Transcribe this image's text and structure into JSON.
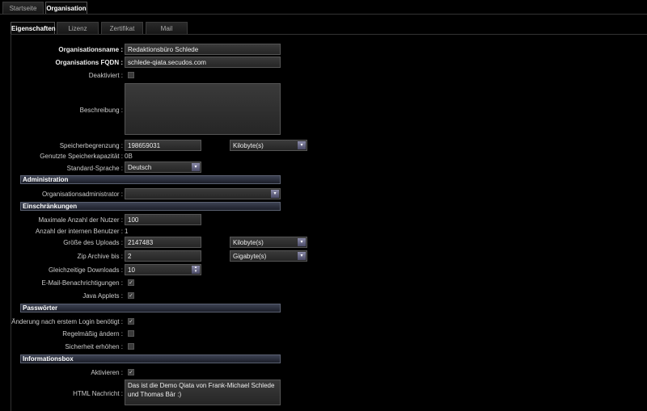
{
  "top_tabs": [
    "Startseite",
    "Organisation"
  ],
  "sub_tabs": [
    "Eigenschaften",
    "Lizenz",
    "Zertifikat",
    "Mail"
  ],
  "fields": {
    "org_name": {
      "label": "Organisationsname :",
      "value": "Redaktionsbüro Schlede"
    },
    "fqdn": {
      "label": "Organisations FQDN :",
      "value": "schlede-qiata.secudos.com"
    },
    "deactivated": {
      "label": "Deaktiviert :",
      "checked": false
    },
    "description": {
      "label": "Beschreibung :",
      "value": ""
    },
    "storage_limit": {
      "label": "Speicherbegrenzung :",
      "value": "198659031",
      "unit": "Kilobyte(s)"
    },
    "storage_used": {
      "label": "Genutzte Speicherkapazität :",
      "value": "0B"
    },
    "language": {
      "label": "Standard-Sprache :",
      "value": "Deutsch"
    }
  },
  "administration": {
    "title": "Administration",
    "admin_label": "Organisationsadministrator :",
    "admin_value": ""
  },
  "restrictions": {
    "title": "Einschränkungen",
    "max_users": {
      "label": "Maximale Anzahl der Nutzer :",
      "value": "100"
    },
    "internal_users": {
      "label": "Anzahl der internen Benutzer :",
      "value": "1"
    },
    "upload_size": {
      "label": "Größe des Uploads :",
      "value": "2147483",
      "unit": "Kilobyte(s)"
    },
    "zip": {
      "label": "Zip Archive bis :",
      "value": "2",
      "unit": "Gigabyte(s)"
    },
    "downloads": {
      "label": "Gleichzeitige Downloads :",
      "value": "10"
    },
    "email": {
      "label": "E-Mail-Benachrichtigungen :",
      "checked": true
    },
    "java": {
      "label": "Java Applets :",
      "checked": true
    }
  },
  "passwords": {
    "title": "Passwörter",
    "change_first": {
      "label": "Änderung nach erstem Login benötigt :",
      "checked": true
    },
    "regular": {
      "label": "Regelmäßig ändern :",
      "checked": false
    },
    "security": {
      "label": "Sicherheit erhöhen :",
      "checked": false
    }
  },
  "infobox": {
    "title": "Informationsbox",
    "activate": {
      "label": "Aktivieren :",
      "checked": true
    },
    "html": {
      "label": "HTML Nachricht :",
      "value": "Das ist die Demo Qiata von Frank-Michael Schlede und Thomas Bär :)"
    }
  },
  "icons": {
    "check": "✓",
    "arrow": "▾"
  }
}
